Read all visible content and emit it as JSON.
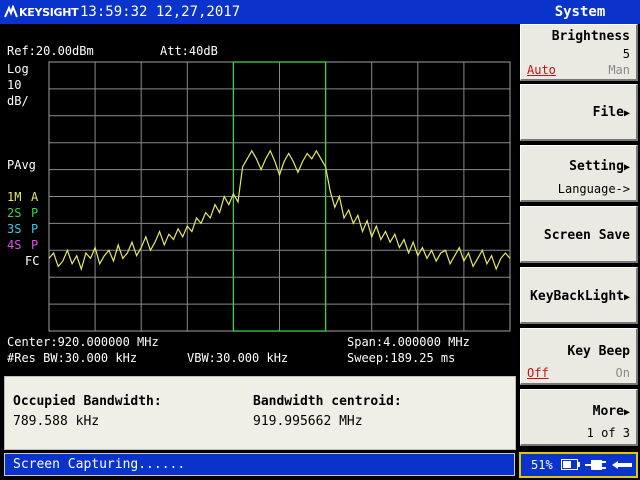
{
  "header": {
    "brand": "KEYSIGHT",
    "datetime": "13:59:32 12,27,2017",
    "menu_title": "System"
  },
  "screen": {
    "ref": "Ref:20.00dBm",
    "att": "Att:40dB",
    "scale_type": "Log",
    "scale_value": "10",
    "scale_unit": "dB/",
    "detector": "PAvg",
    "traces": [
      {
        "num": "1M",
        "mode": "A",
        "color": "#e8e860"
      },
      {
        "num": "2S",
        "mode": "P",
        "color": "#3bd04b"
      },
      {
        "num": "3S",
        "mode": "P",
        "color": "#3ec6e8"
      },
      {
        "num": "4S",
        "mode": "P",
        "color": "#e24de8"
      }
    ],
    "fc": "FC",
    "center": "Center:920.000000 MHz",
    "span": "Span:4.000000 MHz",
    "rbw": "#Res BW:30.000 kHz",
    "vbw": "VBW:30.000 kHz",
    "sweep": "Sweep:189.25 ms"
  },
  "measurement": {
    "obw_label": "Occupied Bandwidth:",
    "obw_value": "789.588 kHz",
    "centroid_label": "Bandwidth centroid:",
    "centroid_value": "919.995662 MHz"
  },
  "status": {
    "message": "Screen Capturing......",
    "battery": "51%"
  },
  "softkeys": {
    "brightness": {
      "label": "Brightness",
      "value": "5",
      "auto": "Auto",
      "man": "Man"
    },
    "file": {
      "label": "File"
    },
    "setting": {
      "label": "Setting",
      "sub": "Language->"
    },
    "screen_save": {
      "label": "Screen Save"
    },
    "keybacklight": {
      "label": "KeyBackLight"
    },
    "keybeep": {
      "label": "Key Beep",
      "off": "Off",
      "on": "On"
    },
    "more": {
      "label": "More",
      "page": "1 of 3"
    }
  },
  "chart_data": {
    "type": "line",
    "title": "",
    "xlabel": "",
    "ylabel": "",
    "x_center_mhz": 920.0,
    "x_span_mhz": 4.0,
    "xlim": [
      918.0,
      922.0
    ],
    "ylim": [
      -80,
      20
    ],
    "y_units": "dBm",
    "grid": true,
    "obw_box_mhz": [
      919.6,
      920.4
    ],
    "series": [
      {
        "color": "#e8e860",
        "x": [
          918.0,
          918.04,
          918.08,
          918.12,
          918.16,
          918.2,
          918.24,
          918.28,
          918.32,
          918.36,
          918.4,
          918.44,
          918.48,
          918.52,
          918.56,
          918.6,
          918.64,
          918.68,
          918.72,
          918.76,
          918.8,
          918.84,
          918.88,
          918.92,
          918.96,
          919.0,
          919.04,
          919.08,
          919.12,
          919.16,
          919.2,
          919.24,
          919.28,
          919.32,
          919.36,
          919.4,
          919.44,
          919.48,
          919.52,
          919.56,
          919.6,
          919.64,
          919.68,
          919.72,
          919.76,
          919.8,
          919.84,
          919.88,
          919.92,
          919.96,
          920.0,
          920.04,
          920.08,
          920.12,
          920.16,
          920.2,
          920.24,
          920.28,
          920.32,
          920.36,
          920.4,
          920.44,
          920.48,
          920.52,
          920.56,
          920.6,
          920.64,
          920.68,
          920.72,
          920.76,
          920.8,
          920.84,
          920.88,
          920.92,
          920.96,
          921.0,
          921.04,
          921.08,
          921.12,
          921.16,
          921.2,
          921.24,
          921.28,
          921.32,
          921.36,
          921.4,
          921.44,
          921.48,
          921.52,
          921.56,
          921.6,
          921.64,
          921.68,
          921.72,
          921.76,
          921.8,
          921.84,
          921.88,
          921.92,
          921.96,
          922.0
        ],
        "y": [
          -53,
          -51,
          -56,
          -54,
          -50,
          -55,
          -52,
          -57,
          -51,
          -53,
          -49,
          -55,
          -52,
          -50,
          -54,
          -48,
          -53,
          -51,
          -47,
          -52,
          -49,
          -45,
          -50,
          -47,
          -43,
          -48,
          -44,
          -46,
          -42,
          -45,
          -41,
          -43,
          -38,
          -40,
          -36,
          -38,
          -33,
          -36,
          -30,
          -33,
          -29,
          -32,
          -19,
          -16,
          -13,
          -16,
          -20,
          -16,
          -13,
          -17,
          -22,
          -17,
          -14,
          -17,
          -21,
          -17,
          -14,
          -16,
          -13,
          -16,
          -19,
          -28,
          -34,
          -30,
          -38,
          -35,
          -40,
          -37,
          -43,
          -39,
          -45,
          -41,
          -46,
          -43,
          -47,
          -44,
          -49,
          -46,
          -51,
          -47,
          -52,
          -49,
          -53,
          -50,
          -54,
          -51,
          -50,
          -55,
          -52,
          -49,
          -54,
          -51,
          -56,
          -53,
          -50,
          -55,
          -52,
          -57,
          -53,
          -51,
          -53
        ]
      }
    ]
  }
}
